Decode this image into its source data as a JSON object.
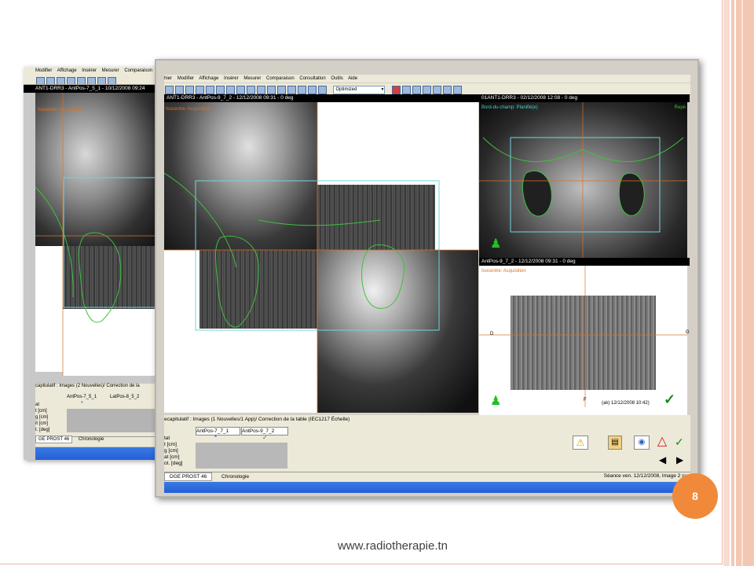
{
  "colors": {
    "stripe_outer": "#f4c7b3",
    "stripe_inner": "#f8dcd0",
    "badge": "#f08a3a",
    "contour_green": "#3fbf3f",
    "field_cyan": "#6fd5e0",
    "axis_orange": "#e07020"
  },
  "back_window": {
    "menu": [
      "Modifier",
      "Affichage",
      "Insérer",
      "Mesurer",
      "Comparaison"
    ],
    "title": "ANT1-DRR3 - AntPos-7_5_1 - 10/12/2008 09:24",
    "overlay_label": "Isocentre: Acquisition",
    "summary_title": "capitulatif : Images (2 Nouvelles)/  Correction de la",
    "col1": "AntPos-7_5_1",
    "col2": "LatPos-8_5_2",
    "row_labels": [
      "at",
      "t [cm]",
      "g [cm]",
      "it [cm]",
      "t. [deg]"
    ],
    "tab_patient": "GE PROST 46",
    "tab_chrono": "Chronologie"
  },
  "front_window": {
    "menu": [
      "hier",
      "Modifier",
      "Affichage",
      "Insérer",
      "Mesurer",
      "Comparaison",
      "Consultation",
      "Outils",
      "Aide"
    ],
    "toolbar_select": "Optimized",
    "main_title": "ANT1-DRR3 - AntPos-9_7_2 - 12/12/2008 09:31 - 0 deg",
    "main_label": "Isocentre: Acquisition",
    "top_right_title": "01ANT1-DRR3 - 02/12/2008 12:08 - 0 deg",
    "top_right_label": "Bord-du-champ: Planifié(e)",
    "top_right_corner": "Repè",
    "bottom_right_title": "AntPos-9_7_2 - 12/12/2008 09:31 - 0 deg",
    "bottom_right_label": "Isocentre: Acquisition",
    "bottom_right_stamp": "(ak)  12/12/2008 10:42)",
    "axis_d": "D",
    "axis_f": "F",
    "axis_g": "G",
    "summary_title": "ecapitulatif : Images (1 Nouvelles/1 App)/  Correction de la table (IEC1217 Échelle)",
    "col1": "AntPos-7_7_1",
    "col2": "AntPos-9_7_2",
    "star": "*",
    "check": "✓",
    "row_labels": [
      "tat",
      "t [cm]",
      "g [cm]",
      "at [cm]",
      "ot. [deg]"
    ],
    "tab_patient": "DGE PROST 46",
    "tab_chrono": "Chronologie",
    "session_text": "Séance ven. 12/12/2008, Image 2 su"
  },
  "page_number": "8",
  "footer_url": "www.radiotherapie.tn"
}
